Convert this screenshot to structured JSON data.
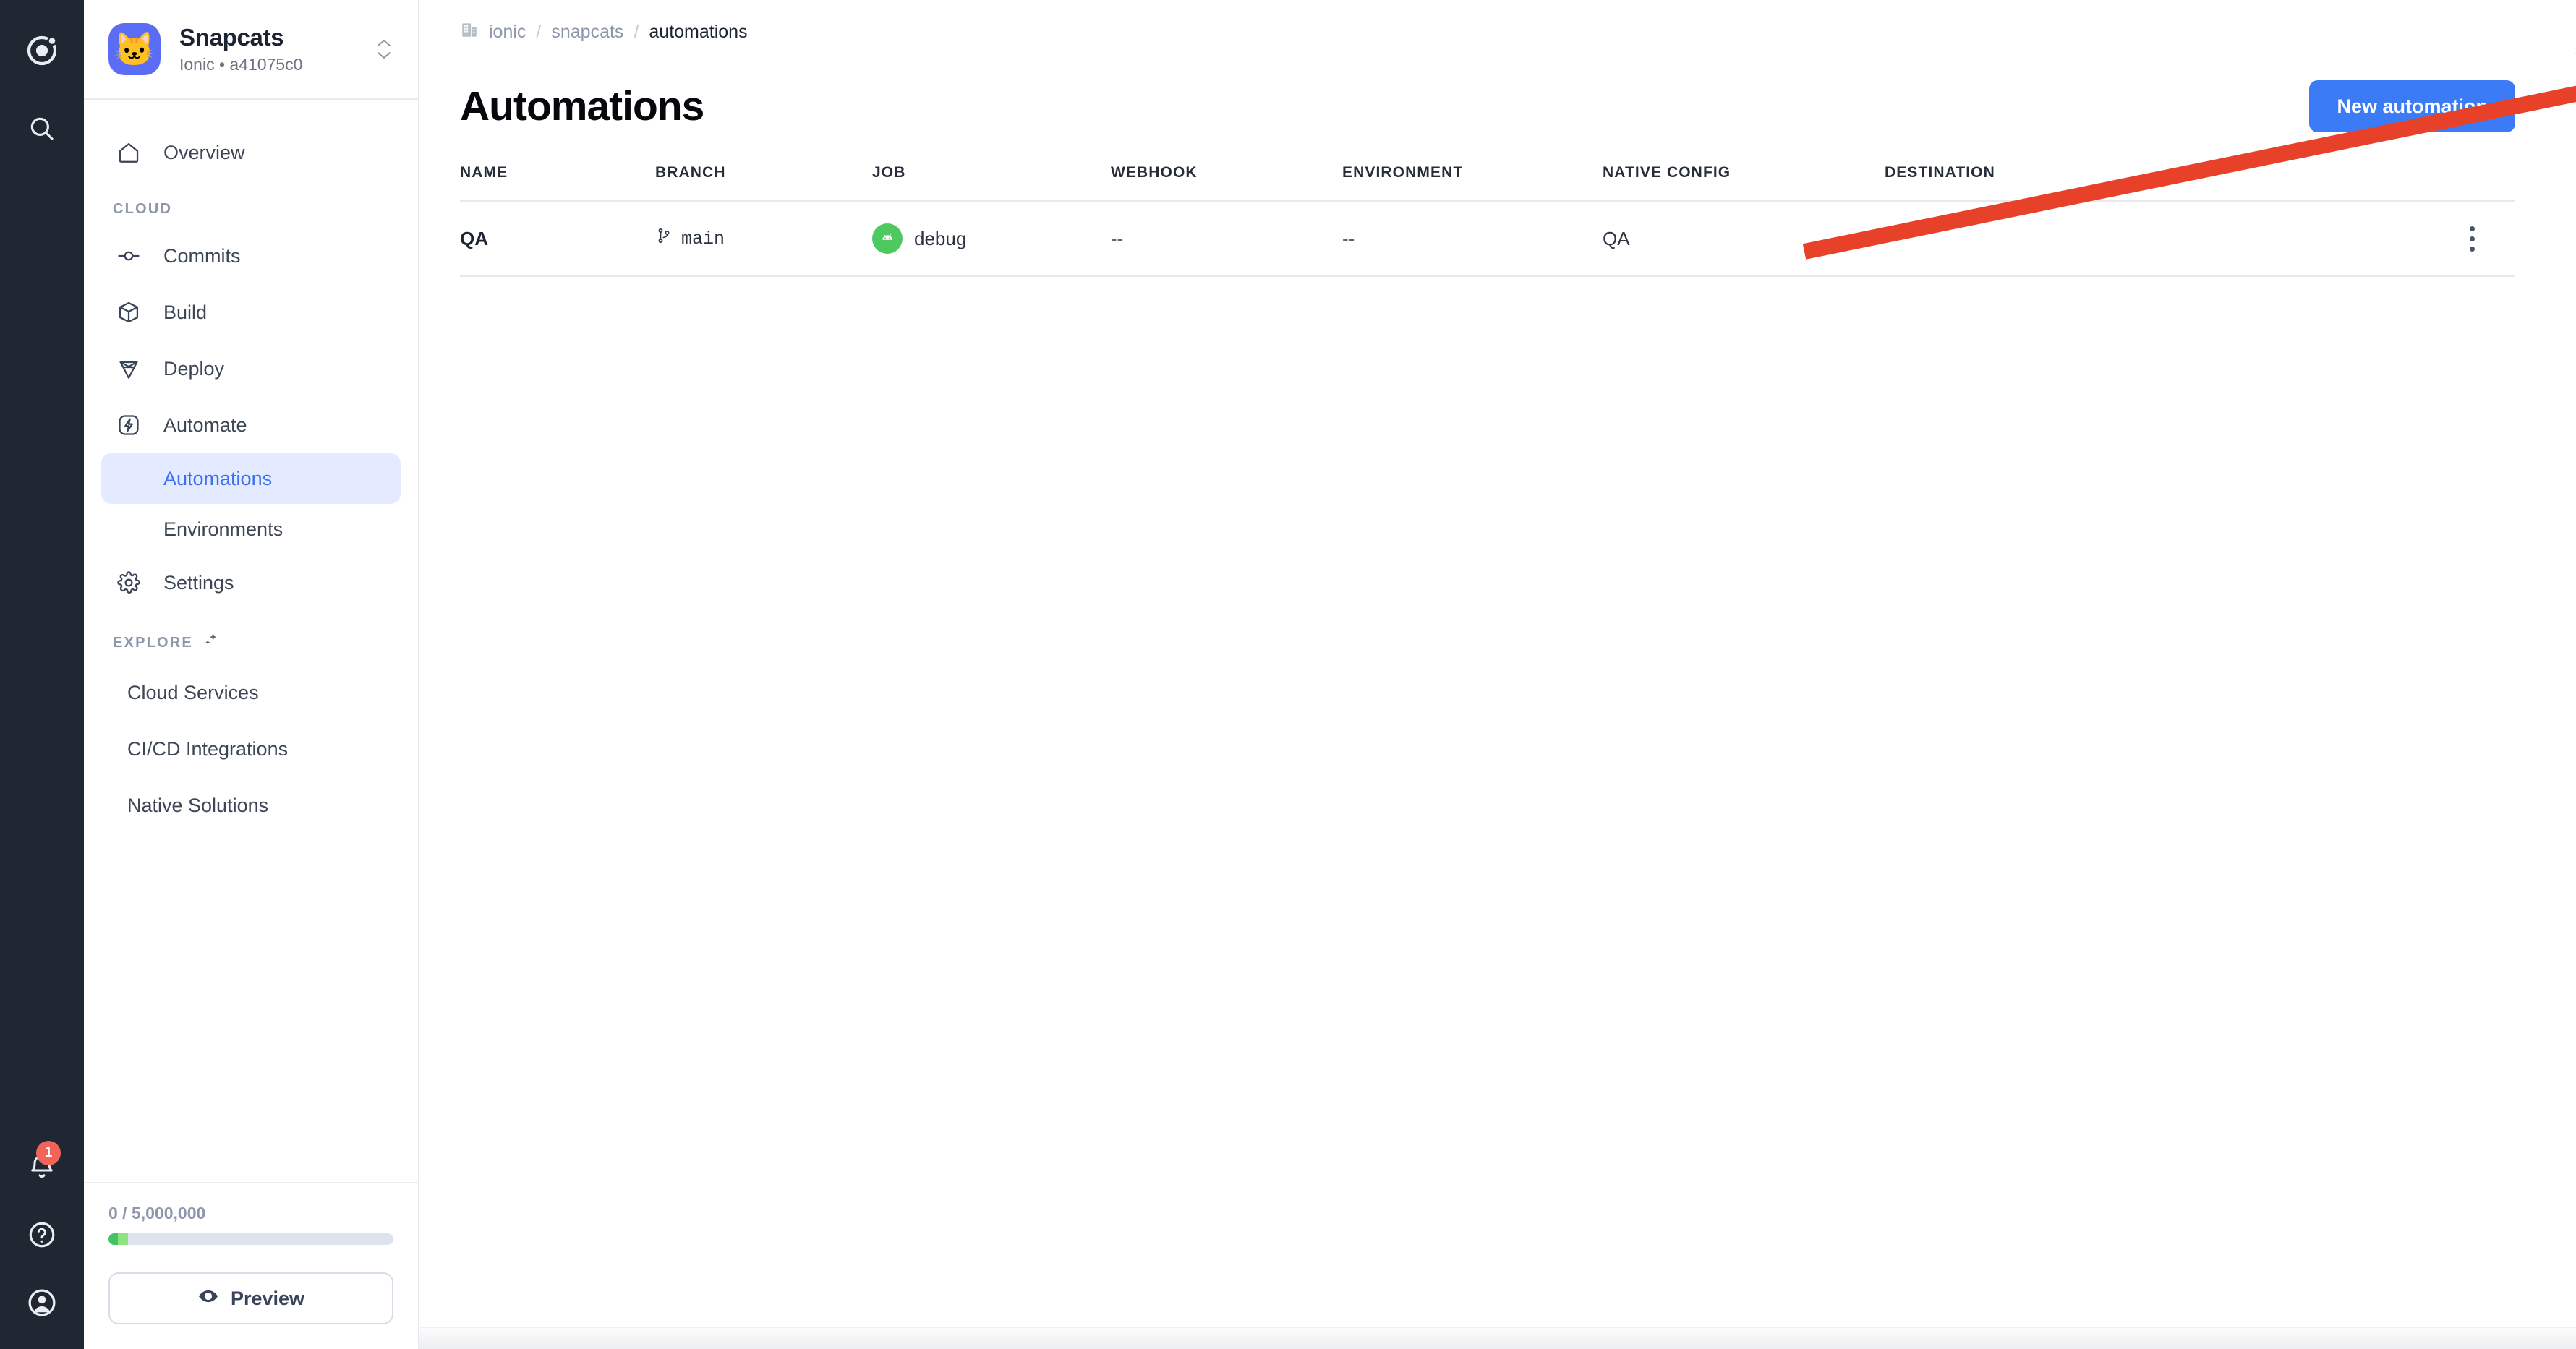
{
  "rail": {
    "logo_icon": "ionic-logo-icon",
    "search_icon": "search-icon",
    "notifications_icon": "bell-icon",
    "notifications_count": "1",
    "help_icon": "help-circle-icon",
    "account_icon": "user-account-icon"
  },
  "project": {
    "avatar_emoji": "🐱",
    "name": "Snapcats",
    "subtitle": "Ionic • a41075c0",
    "switcher_icon": "chevron-up-down-icon"
  },
  "sidebar": {
    "overview": {
      "label": "Overview",
      "icon": "home-icon"
    },
    "cloud_section": "CLOUD",
    "cloud_items": [
      {
        "label": "Commits",
        "icon": "commit-icon"
      },
      {
        "label": "Build",
        "icon": "cube-icon"
      },
      {
        "label": "Deploy",
        "icon": "deploy-diamond-icon"
      }
    ],
    "automate": {
      "label": "Automate",
      "icon": "lightning-bolt-icon"
    },
    "automate_children": [
      {
        "label": "Automations",
        "active": true
      },
      {
        "label": "Environments",
        "active": false
      }
    ],
    "settings": {
      "label": "Settings",
      "icon": "gear-icon"
    },
    "explore_section": "EXPLORE",
    "explore_icon": "sparkles-icon",
    "explore_items": [
      {
        "label": "Cloud Services"
      },
      {
        "label": "CI/CD Integrations"
      },
      {
        "label": "Native Solutions"
      }
    ],
    "footer": {
      "usage_text": "0 / 5,000,000",
      "usage_used": 0,
      "usage_total": 5000000,
      "preview_label": "Preview",
      "preview_icon": "eye-icon"
    }
  },
  "breadcrumb": {
    "org_icon": "building-icon",
    "org": "ionic",
    "separator": "/",
    "project": "snapcats",
    "current": "automations"
  },
  "header": {
    "title": "Automations",
    "new_automation_label": "New automation"
  },
  "table": {
    "columns": [
      "NAME",
      "BRANCH",
      "JOB",
      "WEBHOOK",
      "ENVIRONMENT",
      "NATIVE CONFIG",
      "DESTINATION"
    ],
    "rows": [
      {
        "name": "QA",
        "branch": "main",
        "branch_icon": "git-branch-icon",
        "job": "debug",
        "job_icon": "android-icon",
        "webhook": "--",
        "environment": "--",
        "native_config": "QA",
        "destination": "--",
        "actions_icon": "kebab-menu-icon"
      }
    ]
  },
  "annotation": {
    "type": "arrow",
    "color": "#e8412a",
    "points_to": "new-automation-button"
  },
  "colors": {
    "accent_blue": "#3b7bf6",
    "rail_dark": "#1f2733",
    "active_nav_bg": "#e4eaff",
    "active_nav_text": "#3b6ef3",
    "badge_red": "#f2645a",
    "android_green": "#4ec95f",
    "annotation_red": "#e8412a"
  }
}
